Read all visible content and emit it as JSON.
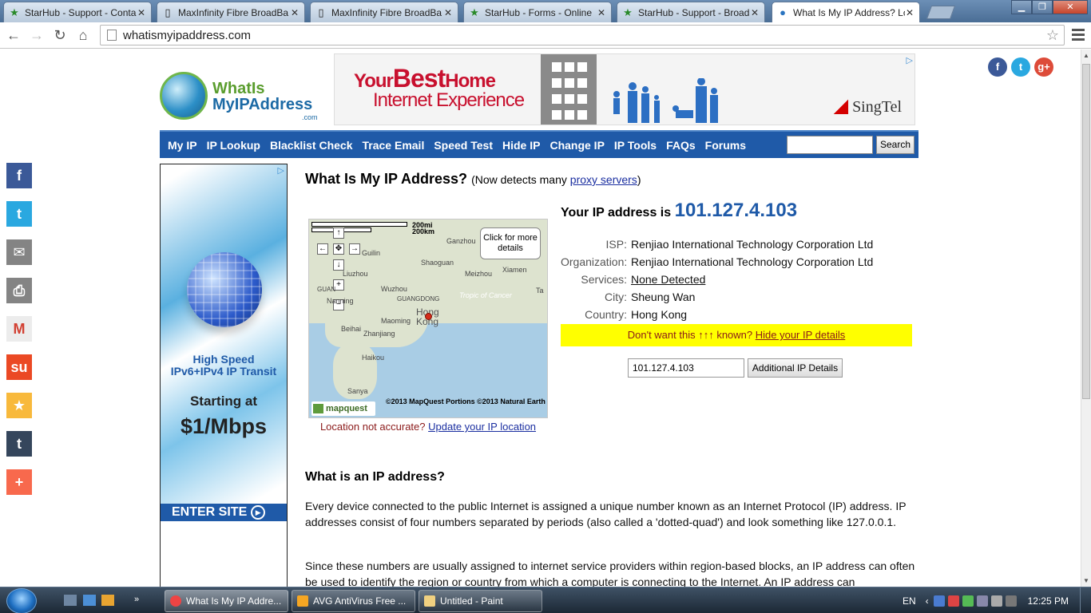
{
  "browser": {
    "tabs": [
      {
        "title": "StarHub - Support - Conta",
        "icon": "starhub-star-icon"
      },
      {
        "title": "MaxInfinity Fibre BroadBa",
        "icon": "page-icon"
      },
      {
        "title": "MaxInfinity Fibre BroadBa",
        "icon": "page-icon"
      },
      {
        "title": "StarHub - Forms - Online",
        "icon": "starhub-star-icon"
      },
      {
        "title": "StarHub - Support - Broad",
        "icon": "starhub-star-icon"
      },
      {
        "title": "What Is My IP Address? Lo",
        "icon": "globe-icon",
        "active": true
      }
    ],
    "url": "whatismyipaddress.com"
  },
  "site": {
    "logo": {
      "line1": "WhatIs",
      "line2": "MyIPAddress",
      "suffix": ".com"
    },
    "banner_ad": {
      "headline_best": "Best",
      "line1_pre": "Your",
      "line1_post": "Home",
      "line2": "Internet Experience",
      "brand": "SingTel"
    },
    "nav": [
      "My IP",
      "IP Lookup",
      "Blacklist Check",
      "Trace Email",
      "Speed Test",
      "Hide IP",
      "Change IP",
      "IP Tools",
      "FAQs",
      "Forums"
    ],
    "search": {
      "button": "Search",
      "value": ""
    }
  },
  "side_ad": {
    "line1": "High Speed",
    "line2": "IPv6+IPv4 IP Transit",
    "starting": "Starting at",
    "price": "$1/Mbps",
    "cta": "ENTER SITE"
  },
  "main": {
    "title": "What Is My IP Address?",
    "subtitle_pre": "(Now detects many",
    "subtitle_link": "proxy servers",
    "subtitle_post": ")",
    "ip_label": "Your IP address is",
    "ip": "101.127.4.103",
    "details": [
      {
        "key": "ISP:",
        "value": "Renjiao International Technology Corporation Ltd"
      },
      {
        "key": "Organization:",
        "value": "Renjiao International Technology Corporation Ltd"
      },
      {
        "key": "Services:",
        "value": "None Detected",
        "link": true
      },
      {
        "key": "City:",
        "value": "Sheung Wan"
      },
      {
        "key": "Country:",
        "value": "Hong Kong"
      }
    ],
    "warning_text": "Don't want this ↑↑↑ known?",
    "warning_link": "Hide your IP details",
    "lookup_value": "101.127.4.103",
    "lookup_button": "Additional IP Details",
    "location_note": "Location not accurate?",
    "location_link": "Update your IP location"
  },
  "map": {
    "scale_top": "200mi",
    "scale_bottom": "200km",
    "popup": "Click for more details",
    "copyright": "©2013 MapQuest  Portions ©2013 Natural Earth",
    "brand": "mapquest",
    "places": [
      "Ganzhou",
      "Guilin",
      "Shaoguan",
      "Meizhou",
      "Xiamen",
      "Liuzhou",
      "Wuzhou",
      "GUANGDONG",
      "Tropic of Cancer",
      "Nanning",
      "Beihai",
      "Maoming",
      "Zhanjiang",
      "Haikou",
      "Sanya",
      "GUAN",
      "Ta"
    ],
    "hk_label": "Hong Kong"
  },
  "article": {
    "heading": "What is an IP address?",
    "p1": "Every device connected to the public Internet is assigned a unique number known as an Internet Protocol (IP) address. IP addresses consist of four numbers separated by periods (also called a 'dotted-quad') and look something like 127.0.0.1.",
    "p2": "Since these numbers are usually assigned to internet service providers within region-based blocks, an IP address can often be used to identify the region or country from which a computer is connecting to the Internet. An IP address can"
  },
  "share_bar": [
    "facebook-icon",
    "twitter-icon",
    "email-icon",
    "print-icon",
    "gmail-icon",
    "stumbleupon-icon",
    "favorites-icon",
    "tumblr-icon",
    "more-icon"
  ],
  "taskbar": {
    "tasks": [
      "What Is My IP Addre...",
      "AVG AntiVirus Free ...",
      "Untitled - Paint"
    ],
    "lang": "EN",
    "time": "12:25 PM"
  }
}
